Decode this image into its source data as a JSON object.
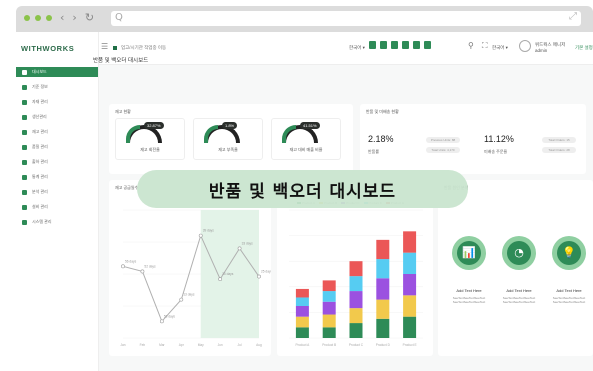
{
  "browser": {
    "nav_glyphs": [
      "‹",
      "›",
      "↻"
    ],
    "search_glyph": "Q",
    "expand_glyph": "⤢"
  },
  "app": {
    "logo": "WITHWORKS",
    "menu_glyph": "☰",
    "sidebar": {
      "items": [
        {
          "label": "대시보드",
          "active": true
        },
        {
          "label": "기준 정보",
          "active": false
        },
        {
          "label": "자재 관리",
          "active": false
        },
        {
          "label": "생산관리",
          "active": false
        },
        {
          "label": "재고 관리",
          "active": false
        },
        {
          "label": "품질 관리",
          "active": false
        },
        {
          "label": "출하 관리",
          "active": false
        },
        {
          "label": "통계 관리",
          "active": false
        },
        {
          "label": "분석 관리",
          "active": false
        },
        {
          "label": "설비 관리",
          "active": false
        },
        {
          "label": "시스템 관리",
          "active": false
        }
      ]
    },
    "header": {
      "breadcrumb": "업고/시기관 작업중 이동",
      "language": "한국어 ▾",
      "util_glyphs": [
        "⚲",
        "⛶"
      ],
      "lang_short": "한국어 ▾",
      "user_name": "위드웍스 매니저",
      "user_role": "admin",
      "settings_link": "기본 설정"
    },
    "page_title": "반품 및 백오더 대시보드",
    "overlay_title": "반품 및 백오더 대시보드"
  },
  "cards": {
    "gauges_title": "재고 현황",
    "gauges": [
      {
        "bubble": "32.87%",
        "label": "재고 회전율"
      },
      {
        "bubble": "1.8%",
        "label": "재고 부족율"
      },
      {
        "bubble": "41.51%",
        "label": "재고 대비 매출 비율"
      }
    ],
    "returns_title": "반품 및 미배송 현황",
    "returns": [
      {
        "value": "2.18%",
        "label": "반품률",
        "pills": [
          "Previous Units: 88",
          "Total Units: 4,170"
        ]
      },
      {
        "value": "11.12%",
        "label": "미배송 주문율",
        "pills": [
          "Total Orders: 15",
          "Total Orders: 28"
        ]
      }
    ],
    "line_title": "재고 공급일수",
    "line_labels": [
      "56 days",
      "52 days",
      "58 days",
      "13 days",
      "39 days",
      "35 days",
      "33 days",
      "25 days"
    ],
    "line_x_ticks": [
      "Jan",
      "Feb",
      "Mar",
      "Apr",
      "May",
      "Jun",
      "Jul",
      "Aug"
    ],
    "bar_title": "품목별 재고 현황",
    "bar_legend": [
      "Product A",
      "Product B",
      "Product C",
      "Product D",
      "Product E"
    ],
    "bar_x_ticks": [
      "Product A",
      "Product B",
      "Product C",
      "Product D",
      "Product E"
    ],
    "analysis_title": "반품 원인 분석",
    "analysis_items": [
      {
        "icon": "bar-chart-icon",
        "glyph": "📊",
        "title": "Add Text Here",
        "sub": "SeeTextSeeTextSeeText SeeTextSeeTextSeeText"
      },
      {
        "icon": "pie-chart-icon",
        "glyph": "◔",
        "title": "Add Text Here",
        "sub": "SeeTextSeeTextSeeText SeeTextSeeTextSeeText"
      },
      {
        "icon": "lightbulb-icon",
        "glyph": "💡",
        "title": "Add Text Here",
        "sub": "SeeTextSeeTextSeeText SeeTextSeeTextSeeText"
      }
    ]
  },
  "chart_data": [
    {
      "type": "line",
      "title": "재고 공급일수",
      "x": [
        "Jan",
        "Feb",
        "Mar",
        "Apr",
        "May",
        "Jun",
        "Jul",
        "Aug"
      ],
      "series": [
        {
          "values": [
            56,
            52,
            13,
            30,
            80,
            46,
            70,
            48
          ]
        }
      ],
      "ylim": [
        0,
        100
      ]
    },
    {
      "type": "bar",
      "title": "품목별 재고 현황",
      "categories": [
        "Product A",
        "Product B",
        "Product C",
        "Product D",
        "Product E"
      ],
      "series": [
        {
          "name": "Product A",
          "values": [
            10,
            10,
            14,
            18,
            20
          ]
        },
        {
          "name": "Product B",
          "values": [
            10,
            12,
            14,
            18,
            20
          ]
        },
        {
          "name": "Product C",
          "values": [
            10,
            12,
            16,
            20,
            20
          ]
        },
        {
          "name": "Product D",
          "values": [
            8,
            10,
            14,
            18,
            20
          ]
        },
        {
          "name": "Product E",
          "values": [
            8,
            10,
            14,
            18,
            20
          ]
        }
      ],
      "ylim": [
        0,
        120
      ]
    }
  ]
}
